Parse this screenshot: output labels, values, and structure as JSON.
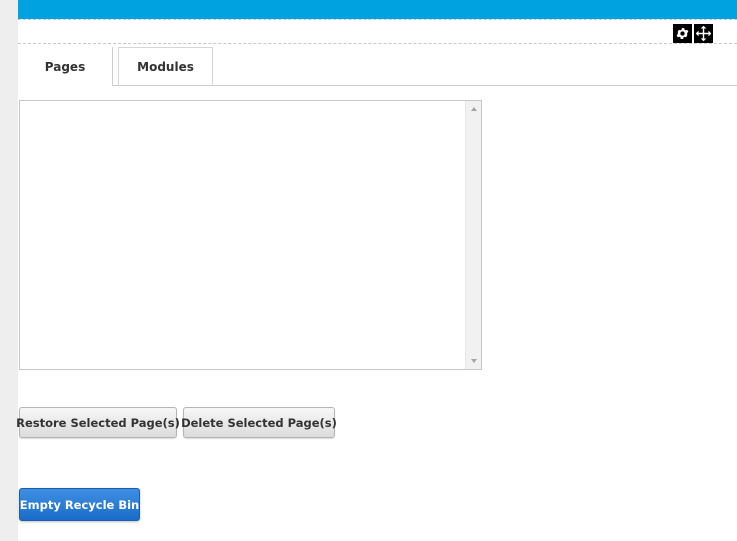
{
  "colors": {
    "top_bar": "#00a3e0",
    "primary_button": "#1b6cc8"
  },
  "module_actions": {
    "icons": [
      "gear-icon",
      "move-icon"
    ]
  },
  "tabs": [
    {
      "label": "Pages",
      "active": true
    },
    {
      "label": "Modules",
      "active": false
    }
  ],
  "pages_list": {
    "items": []
  },
  "buttons": {
    "restore_label": "Restore Selected Page(s)",
    "delete_label": "Delete Selected Page(s)",
    "empty_label": "Empty Recycle Bin"
  }
}
